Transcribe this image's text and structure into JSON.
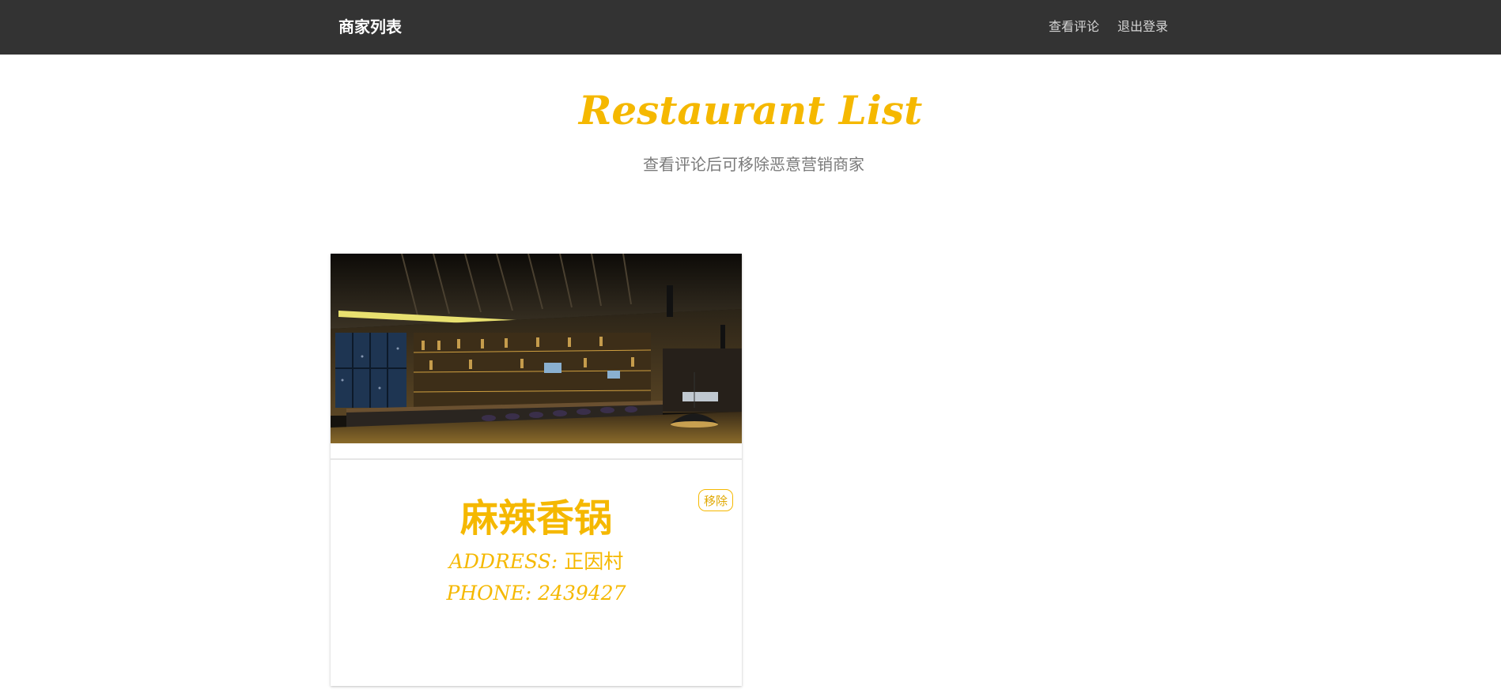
{
  "navbar": {
    "brand": "商家列表",
    "links": [
      "查看评论",
      "退出登录"
    ]
  },
  "hero": {
    "title": "Restaurant List",
    "subtitle": "查看评论后可移除恶意营销商家"
  },
  "restaurants": [
    {
      "name": "麻辣香锅",
      "address_label": "ADDRESS:",
      "address": "正因村",
      "phone_label": "PHONE:",
      "phone": "2439427",
      "remove_label": "移除",
      "image": "restaurant-bar-interior-photo"
    }
  ],
  "colors": {
    "navbar_bg": "#333333",
    "accent": "#f5b800",
    "subtitle": "#7a7a7a"
  }
}
